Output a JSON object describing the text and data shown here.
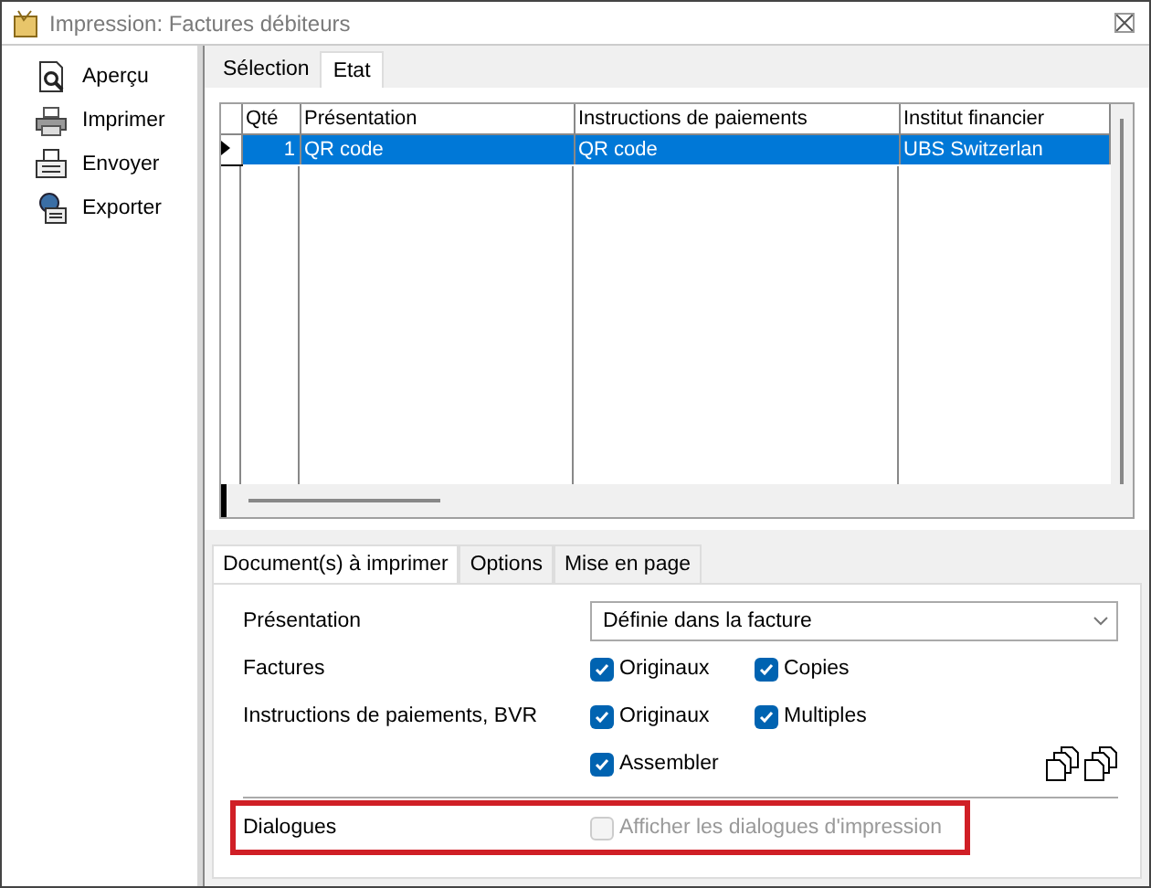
{
  "window": {
    "title": "Impression: Factures débiteurs"
  },
  "sidebar": {
    "items": [
      {
        "label": "Aperçu",
        "kind": "preview"
      },
      {
        "label": "Imprimer",
        "kind": "print"
      },
      {
        "label": "Envoyer",
        "kind": "send"
      },
      {
        "label": "Exporter",
        "kind": "export"
      }
    ]
  },
  "tabs": [
    {
      "label": "Sélection",
      "selected": false
    },
    {
      "label": "Etat",
      "selected": true
    }
  ],
  "table": {
    "columns": [
      "Qté",
      "Présentation",
      "Instructions de paiements",
      "Institut financier"
    ],
    "rows": [
      {
        "cells": [
          "1",
          "QR code",
          "QR code",
          "UBS Switzerlan"
        ],
        "selected": true,
        "current": true
      }
    ]
  },
  "bottom_tabs": [
    {
      "label": "Document(s) à imprimer",
      "selected": true
    },
    {
      "label": "Options",
      "selected": false
    },
    {
      "label": "Mise en page",
      "selected": false
    }
  ],
  "presentation": {
    "label": "Présentation",
    "value": "Définie dans la facture"
  },
  "option_rows": [
    {
      "label": "Factures",
      "options": [
        {
          "label": "Originaux",
          "checked": true
        },
        {
          "label": "Copies",
          "checked": true
        }
      ]
    },
    {
      "label": "Instructions de paiements, BVR",
      "options": [
        {
          "label": "Originaux",
          "checked": true
        },
        {
          "label": "Multiples",
          "checked": true
        }
      ]
    },
    {
      "options": [
        {
          "label": "Assembler",
          "checked": true
        }
      ]
    }
  ],
  "dialogues": {
    "label": "Dialogues",
    "highlighted": true,
    "option": {
      "label": "Afficher les dialogues d'impression",
      "checked": false,
      "disabled": true
    }
  }
}
